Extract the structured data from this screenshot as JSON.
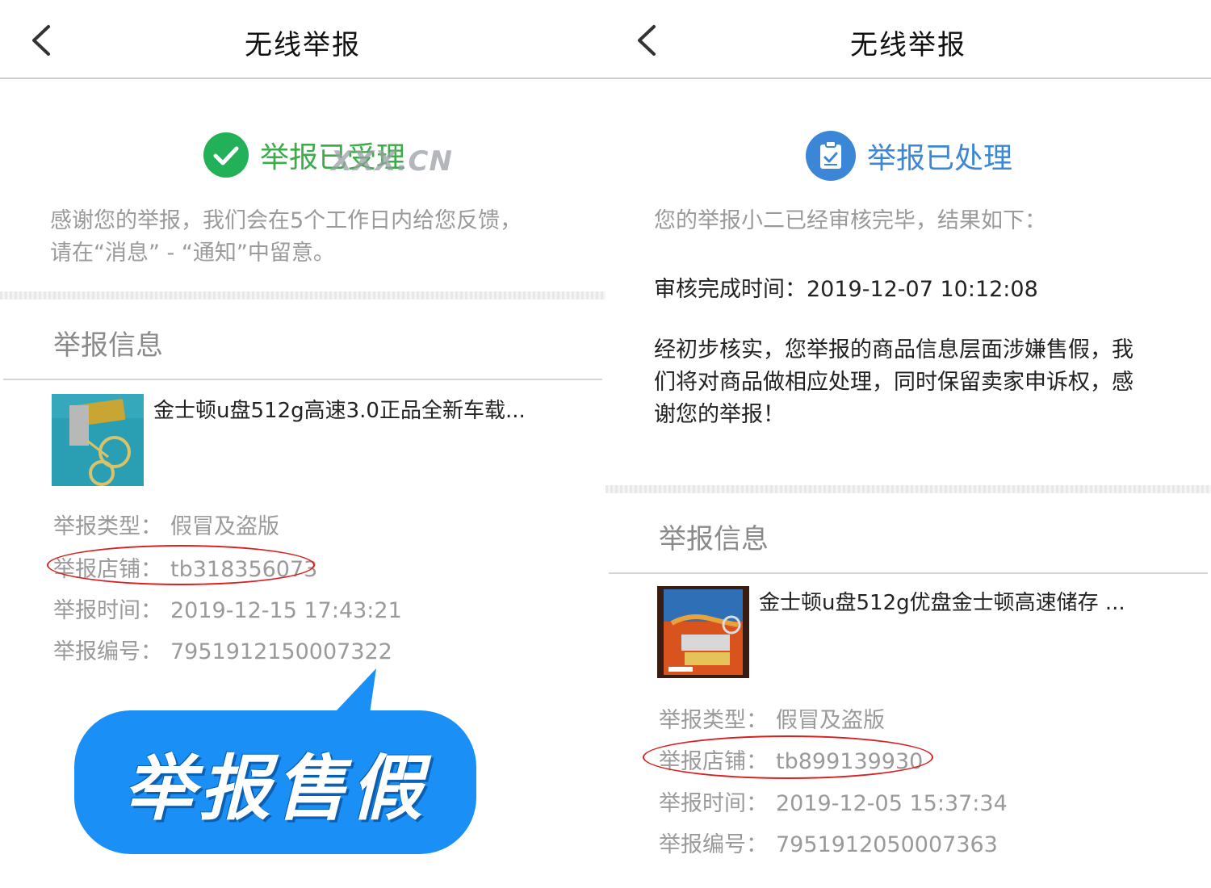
{
  "left": {
    "nav_title": "无线举报",
    "status_text": "举报已受理",
    "watermark": "XXX.CN",
    "note_line1": "感谢您的举报，我们会在5个工作日内给您反馈，",
    "note_line2": "请在“消息” - “通知”中留意。",
    "section_title": "举报信息",
    "product_title": "金士顿u盘512g高速3.0正品全新车载...",
    "type_label": "举报类型：",
    "type_value": "假冒及盗版",
    "shop_label": "举报店铺：",
    "shop_value": "tb318356073",
    "time_label": "举报时间：",
    "time_value": "2019-12-15 17:43:21",
    "id_label": "举报编号：",
    "id_value": "7951912150007322",
    "bubble_text": "举报售假"
  },
  "right": {
    "nav_title": "无线举报",
    "status_text": "举报已处理",
    "intro": "您的举报小二已经审核完毕，结果如下：",
    "review_time": "审核完成时间：2019-12-07 10:12:08",
    "result_line1": "经初步核实，您举报的商品信息层面涉嫌售假，我",
    "result_line2": "们将对商品做相应处理，同时保留卖家申诉权，感",
    "result_line3": "谢您的举报！",
    "section_title": "举报信息",
    "product_title": "金士顿u盘512g优盘金士顿高速储存 ...",
    "type_label": "举报类型：",
    "type_value": "假冒及盗版",
    "shop_label": "举报店铺：",
    "shop_value": "tb899139930",
    "time_label": "举报时间：",
    "time_value": "2019-12-05 15:37:34",
    "id_label": "举报编号：",
    "id_value": "7951912050007363"
  },
  "colors": {
    "success_green": "#3cab4a",
    "processed_blue": "#3c86d8",
    "highlight_red": "#d92020",
    "bubble_blue": "#1a8ff5"
  },
  "icons": {
    "back": "chevron-left-icon",
    "accepted": "check-circle-icon",
    "processed": "clipboard-icon"
  }
}
